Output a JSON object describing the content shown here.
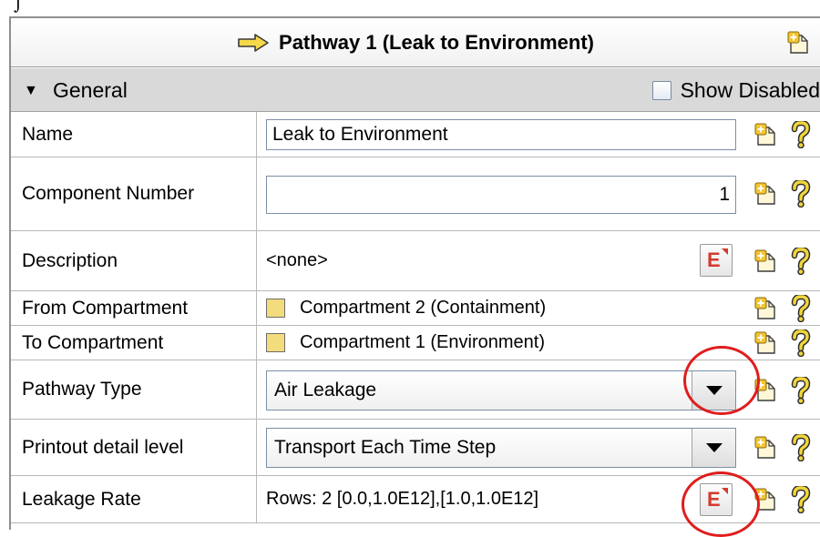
{
  "window": {
    "title": "Pathway 1 (Leak to Environment)",
    "title_icon": "arrow-right-icon",
    "header_action_icon": "note-add-icon"
  },
  "section": {
    "label": "General",
    "expand_icon": "triangle-down-icon",
    "show_disabled_label": "Show Disabled",
    "show_disabled_checked": false
  },
  "properties": [
    {
      "label": "Name",
      "value": "Leak to Environment",
      "control": "textbox"
    },
    {
      "label": "Component Number",
      "value": "1",
      "control": "textbox-right"
    },
    {
      "label": "Description",
      "value": "<none>",
      "control": "editor"
    },
    {
      "label": "From Compartment",
      "value": "Compartment 2 (Containment)",
      "control": "compartment",
      "swatch_color": "#f2dc7b"
    },
    {
      "label": "To Compartment",
      "value": "Compartment 1 (Environment)",
      "control": "compartment",
      "swatch_color": "#f2dc7b"
    },
    {
      "label": "Pathway Type",
      "value": "Air Leakage",
      "control": "dropdown"
    },
    {
      "label": "Printout detail level",
      "value": "Transport Each Time Step",
      "control": "dropdown"
    },
    {
      "label": "Leakage Rate",
      "value": "Rows: 2 [0.0,1.0E12],[1.0,1.0E12]",
      "control": "editor"
    }
  ],
  "colors": {
    "annotation_red": "#e01d1d",
    "editor_icon_red": "#d23b2e",
    "help_icon_yellow": "#f0d53c",
    "section_bg": "#d9d9d9"
  }
}
